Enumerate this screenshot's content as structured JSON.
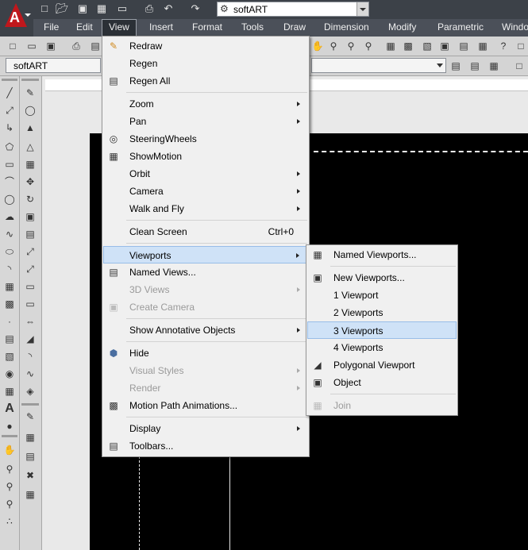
{
  "workspace": {
    "value": "softART"
  },
  "layer_combo": {
    "value": "softART"
  },
  "menubar": {
    "items": [
      {
        "label": "File"
      },
      {
        "label": "Edit"
      },
      {
        "label": "View"
      },
      {
        "label": "Insert"
      },
      {
        "label": "Format"
      },
      {
        "label": "Tools"
      },
      {
        "label": "Draw"
      },
      {
        "label": "Dimension"
      },
      {
        "label": "Modify"
      },
      {
        "label": "Parametric"
      },
      {
        "label": "Windo"
      }
    ]
  },
  "view_menu": {
    "redraw": "Redraw",
    "regen": "Regen",
    "regen_all": "Regen All",
    "zoom": "Zoom",
    "pan": "Pan",
    "steering_wheels": "SteeringWheels",
    "show_motion": "ShowMotion",
    "orbit": "Orbit",
    "camera": "Camera",
    "walk_and_fly": "Walk and Fly",
    "clean_screen": "Clean Screen",
    "clean_screen_shortcut": "Ctrl+0",
    "viewports": "Viewports",
    "named_views": "Named Views...",
    "views_3d": "3D Views",
    "create_camera": "Create Camera",
    "show_annotative_objects": "Show Annotative Objects",
    "hide": "Hide",
    "visual_styles": "Visual Styles",
    "render": "Render",
    "motion_path_animations": "Motion Path Animations...",
    "display": "Display",
    "toolbars": "Toolbars..."
  },
  "viewports_menu": {
    "named_viewports": "Named Viewports...",
    "new_viewports": "New Viewports...",
    "one_viewport": "1 Viewport",
    "two_viewports": "2 Viewports",
    "three_viewports": "3 Viewports",
    "four_viewports": "4 Viewports",
    "polygonal_viewport": "Polygonal Viewport",
    "object": "Object",
    "join": "Join"
  },
  "colors": {
    "highlight": "#cfe2f7",
    "canvas": "#000000",
    "logo_red": "#c0171c"
  }
}
